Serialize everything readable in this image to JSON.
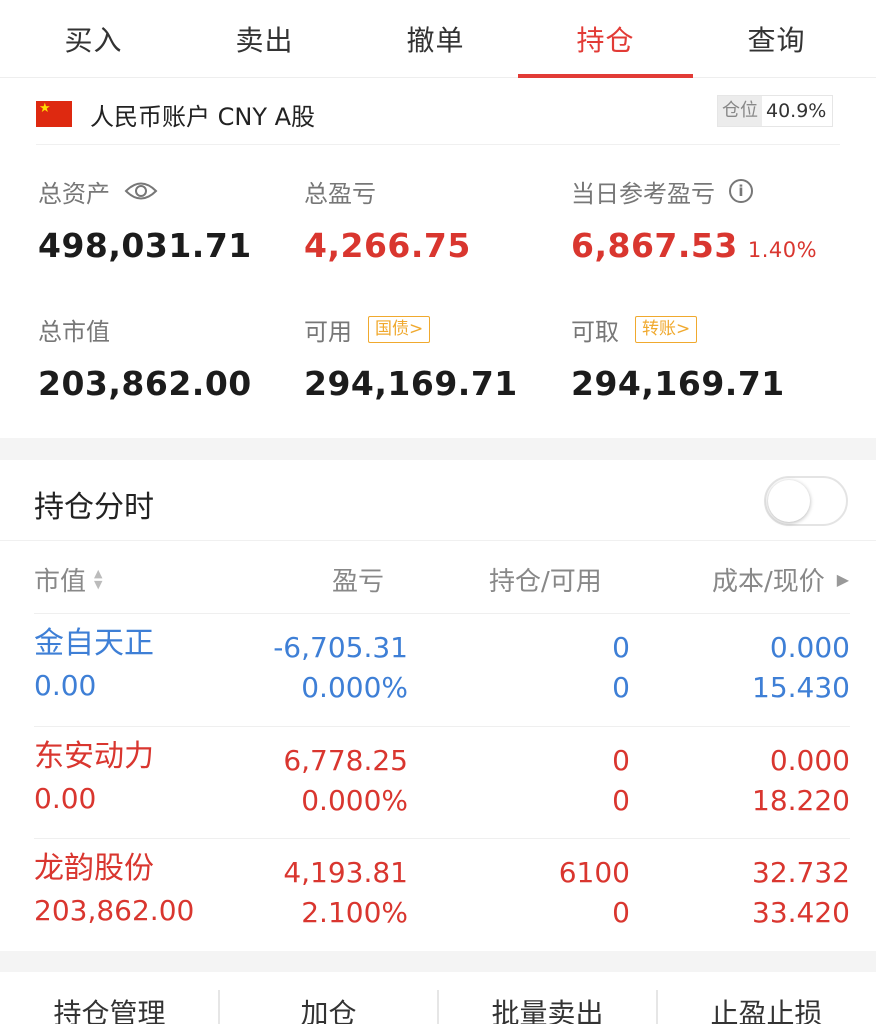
{
  "tabs": [
    {
      "label": "买入"
    },
    {
      "label": "卖出"
    },
    {
      "label": "撤单"
    },
    {
      "label": "持仓",
      "active": true
    },
    {
      "label": "查询"
    }
  ],
  "account": {
    "name": "人民币账户 CNY A股",
    "position_label": "仓位",
    "position_value": "40.9%"
  },
  "summary": {
    "total_assets_label": "总资产",
    "total_assets": "498,031.71",
    "total_pl_label": "总盈亏",
    "total_pl": "4,266.75",
    "daily_pl_label": "当日参考盈亏",
    "daily_pl": "6,867.53",
    "daily_pl_pct": "1.40%",
    "market_value_label": "总市值",
    "market_value": "203,862.00",
    "available_label": "可用",
    "available_tag": "国债>",
    "available": "294,169.71",
    "withdrawable_label": "可取",
    "withdrawable_tag": "转账>",
    "withdrawable": "294,169.71"
  },
  "toggle": {
    "title": "持仓分时",
    "on": false
  },
  "table": {
    "headers": {
      "market_value": "市值",
      "pl": "盈亏",
      "hold": "持仓/可用",
      "cost": "成本/现价"
    },
    "rows": [
      {
        "name": "金自天正",
        "market_value": "0.00",
        "pl": "-6,705.31",
        "pl_ratio": "0.000%",
        "hold": "0",
        "avail": "0",
        "cost": "0.000",
        "price": "15.430",
        "color": "#3e7fd6"
      },
      {
        "name": "东安动力",
        "market_value": "0.00",
        "pl": "6,778.25",
        "pl_ratio": "0.000%",
        "hold": "0",
        "avail": "0",
        "cost": "0.000",
        "price": "18.220",
        "color": "#d9362f"
      },
      {
        "name": "龙韵股份",
        "market_value": "203,862.00",
        "pl": "4,193.81",
        "pl_ratio": "2.100%",
        "hold": "6100",
        "avail": "0",
        "cost": "32.732",
        "price": "33.420",
        "color": "#d9362f"
      }
    ]
  },
  "actions": [
    {
      "label": "持仓管理"
    },
    {
      "label": "加仓"
    },
    {
      "label": "批量卖出"
    },
    {
      "label": "止盈止损"
    }
  ],
  "colors": {
    "accent": "#e23b36",
    "loss": "#3e7fd6",
    "gain": "#d9362f",
    "tag": "#f0a92e"
  }
}
